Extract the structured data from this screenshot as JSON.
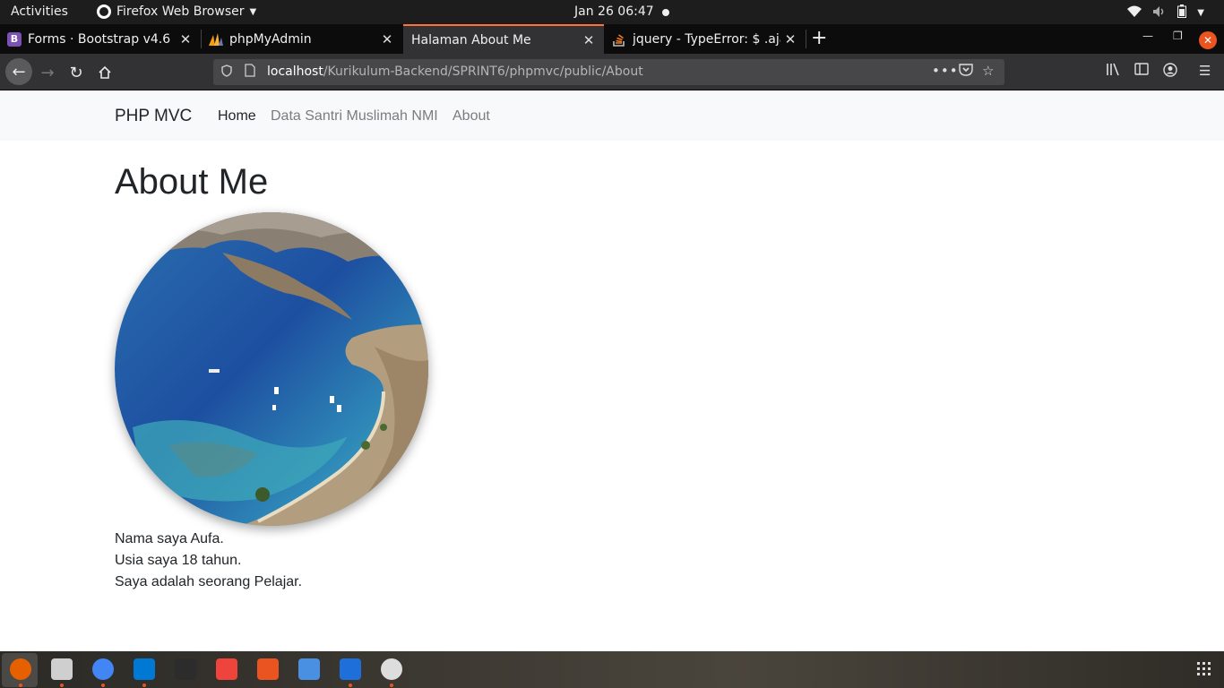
{
  "system_bar": {
    "activities": "Activities",
    "app_name": "Firefox Web Browser",
    "clock": "Jan 26  06:47"
  },
  "browser": {
    "tabs": [
      {
        "title": "Forms · Bootstrap v4.6",
        "favicon": "bootstrap-icon",
        "favicon_letter": "B",
        "favicon_color": "#7952b3",
        "active": false
      },
      {
        "title": "phpMyAdmin",
        "favicon": "phpmyadmin-icon",
        "favicon_color": "#f89c0e",
        "active": false
      },
      {
        "title": "Halaman About Me",
        "favicon": "",
        "active": true
      },
      {
        "title": "jquery - TypeError: $ .aja",
        "favicon": "stackoverflow-icon",
        "favicon_color": "#f48024",
        "active": false
      }
    ],
    "url_host": "localhost",
    "url_path": "/Kurikulum-Backend/SPRINT6/phpmvc/public/About"
  },
  "site": {
    "brand": "PHP MVC",
    "nav": [
      {
        "label": "Home",
        "active": true
      },
      {
        "label": "Data Santri Muslimah NMI",
        "active": false
      },
      {
        "label": "About",
        "active": false
      }
    ],
    "heading": "About Me",
    "image_subject": "aerial coastal lagoon with boats",
    "bio": [
      "Nama saya Aufa.",
      "Usia saya 18 tahun.",
      "Saya adalah seorang Pelajar."
    ]
  },
  "dock": {
    "items": [
      {
        "name": "firefox-icon",
        "color": "#e66000",
        "running": true
      },
      {
        "name": "files-icon",
        "color": "#cfcfcf",
        "running": true
      },
      {
        "name": "chrome-icon",
        "color": "#4285f4",
        "running": true
      },
      {
        "name": "vscode-icon",
        "color": "#0078d4",
        "running": true
      },
      {
        "name": "terminal-icon",
        "color": "#2c2c2c",
        "running": false
      },
      {
        "name": "anydesk-icon",
        "color": "#ef443b",
        "running": false
      },
      {
        "name": "software-center-icon",
        "color": "#e95420",
        "running": false
      },
      {
        "name": "bluetooth-icon",
        "color": "#4a90e2",
        "running": false
      },
      {
        "name": "writer-icon",
        "color": "#1e6fd9",
        "running": true
      },
      {
        "name": "updater-icon",
        "color": "#dddddd",
        "running": true
      }
    ]
  },
  "colors": {
    "accent": "#e95420",
    "tab_active_indicator": "#ff7139",
    "site_navbar_bg": "#f8f9fa",
    "text": "#212529"
  }
}
